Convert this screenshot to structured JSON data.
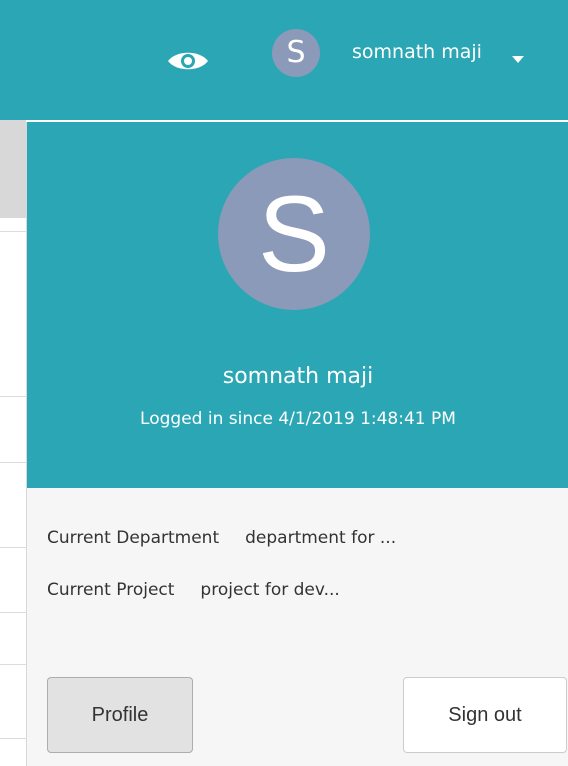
{
  "navbar": {
    "eye_icon": "eye-icon",
    "avatar_letter": "S",
    "user_name": "somnath maji",
    "caret_icon": "caret-down-icon"
  },
  "user_panel": {
    "avatar_letter": "S",
    "name": "somnath maji",
    "logged_in_since": "Logged in since 4/1/2019 1:48:41 PM",
    "department_label": "Current Department",
    "department_value": "department for ...",
    "project_label": "Current Project",
    "project_value": "project for dev...",
    "profile_button": "Profile",
    "signout_button": "Sign out"
  },
  "colors": {
    "header_teal": "#2ba6b4",
    "avatar_bg": "#8b9ab8"
  }
}
